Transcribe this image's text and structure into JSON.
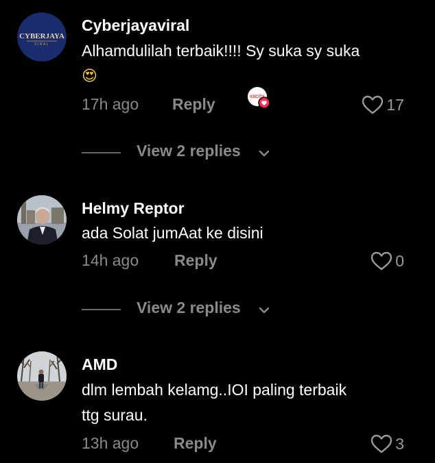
{
  "comments": [
    {
      "username": "Cyberjayaviral",
      "avatar_text": "CYBERJAYA",
      "avatar_subtext": "VIRAL",
      "text": "Alhamdulilah terbaik!!!! Sy suka sy suka",
      "emoji": "😍",
      "time": "17h ago",
      "reply_label": "Reply",
      "creator_liked_badge_text": "IOICITY",
      "likes": "17",
      "view_replies": "View 2 replies"
    },
    {
      "username": "Helmy Reptor",
      "text": "ada Solat jumAat ke disini",
      "time": "14h ago",
      "reply_label": "Reply",
      "likes": "0",
      "view_replies": "View 2 replies"
    },
    {
      "username": "AMD",
      "text_line1": "dlm lembah kelamg..IOI paling terbaik",
      "text_line2": "ttg surau.",
      "time": "13h ago",
      "reply_label": "Reply",
      "likes": "3"
    }
  ],
  "icons": {
    "like": "heart-outline-icon",
    "expand": "chevron-down-icon",
    "creator_like": "heart-filled-badge-icon"
  },
  "colors": {
    "background": "#000000",
    "primary_text": "#ffffff",
    "secondary_text": "#8a8a8a",
    "badge_red": "#fe2c55",
    "avatar_navy": "#1a2c6b",
    "logo_gold": "#c9a14a"
  }
}
